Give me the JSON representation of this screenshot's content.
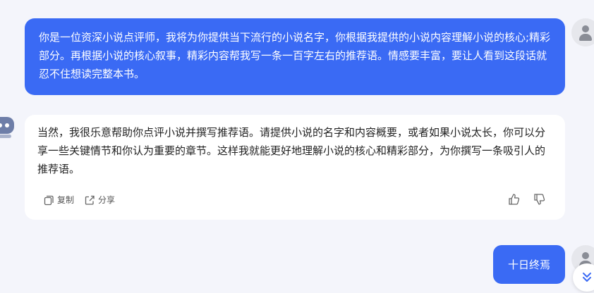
{
  "messages": {
    "user_prompt": "你是一位资深小说点评师，我将为你提供当下流行的小说名字，你根据我提供的小说内容理解小说的核心;精彩部分。再根据小说的核心叙事，精彩内容帮我写一条一百字左右的推荐语。情感要丰富，要让人看到这段话就忍不住想读完整本书。",
    "bot_reply": "当然，我很乐意帮助你点评小说并撰写推荐语。请提供小说的名字和内容概要，或者如果小说太长，你可以分享一些关键情节和你认为重要的章节。这样我就能更好地理解小说的核心和精彩部分，为你撰写一条吸引人的推荐语。",
    "user_followup": "十日终焉"
  },
  "actions": {
    "copy_label": "复制",
    "share_label": "分享"
  },
  "colors": {
    "accent": "#3a6af4",
    "background": "#f4f5fb",
    "card": "#ffffff"
  },
  "icons": {
    "copy": "copy-icon",
    "share": "share-icon",
    "like": "thumbs-up-icon",
    "dislike": "thumbs-down-icon",
    "scroll": "double-chevron-down-icon"
  }
}
